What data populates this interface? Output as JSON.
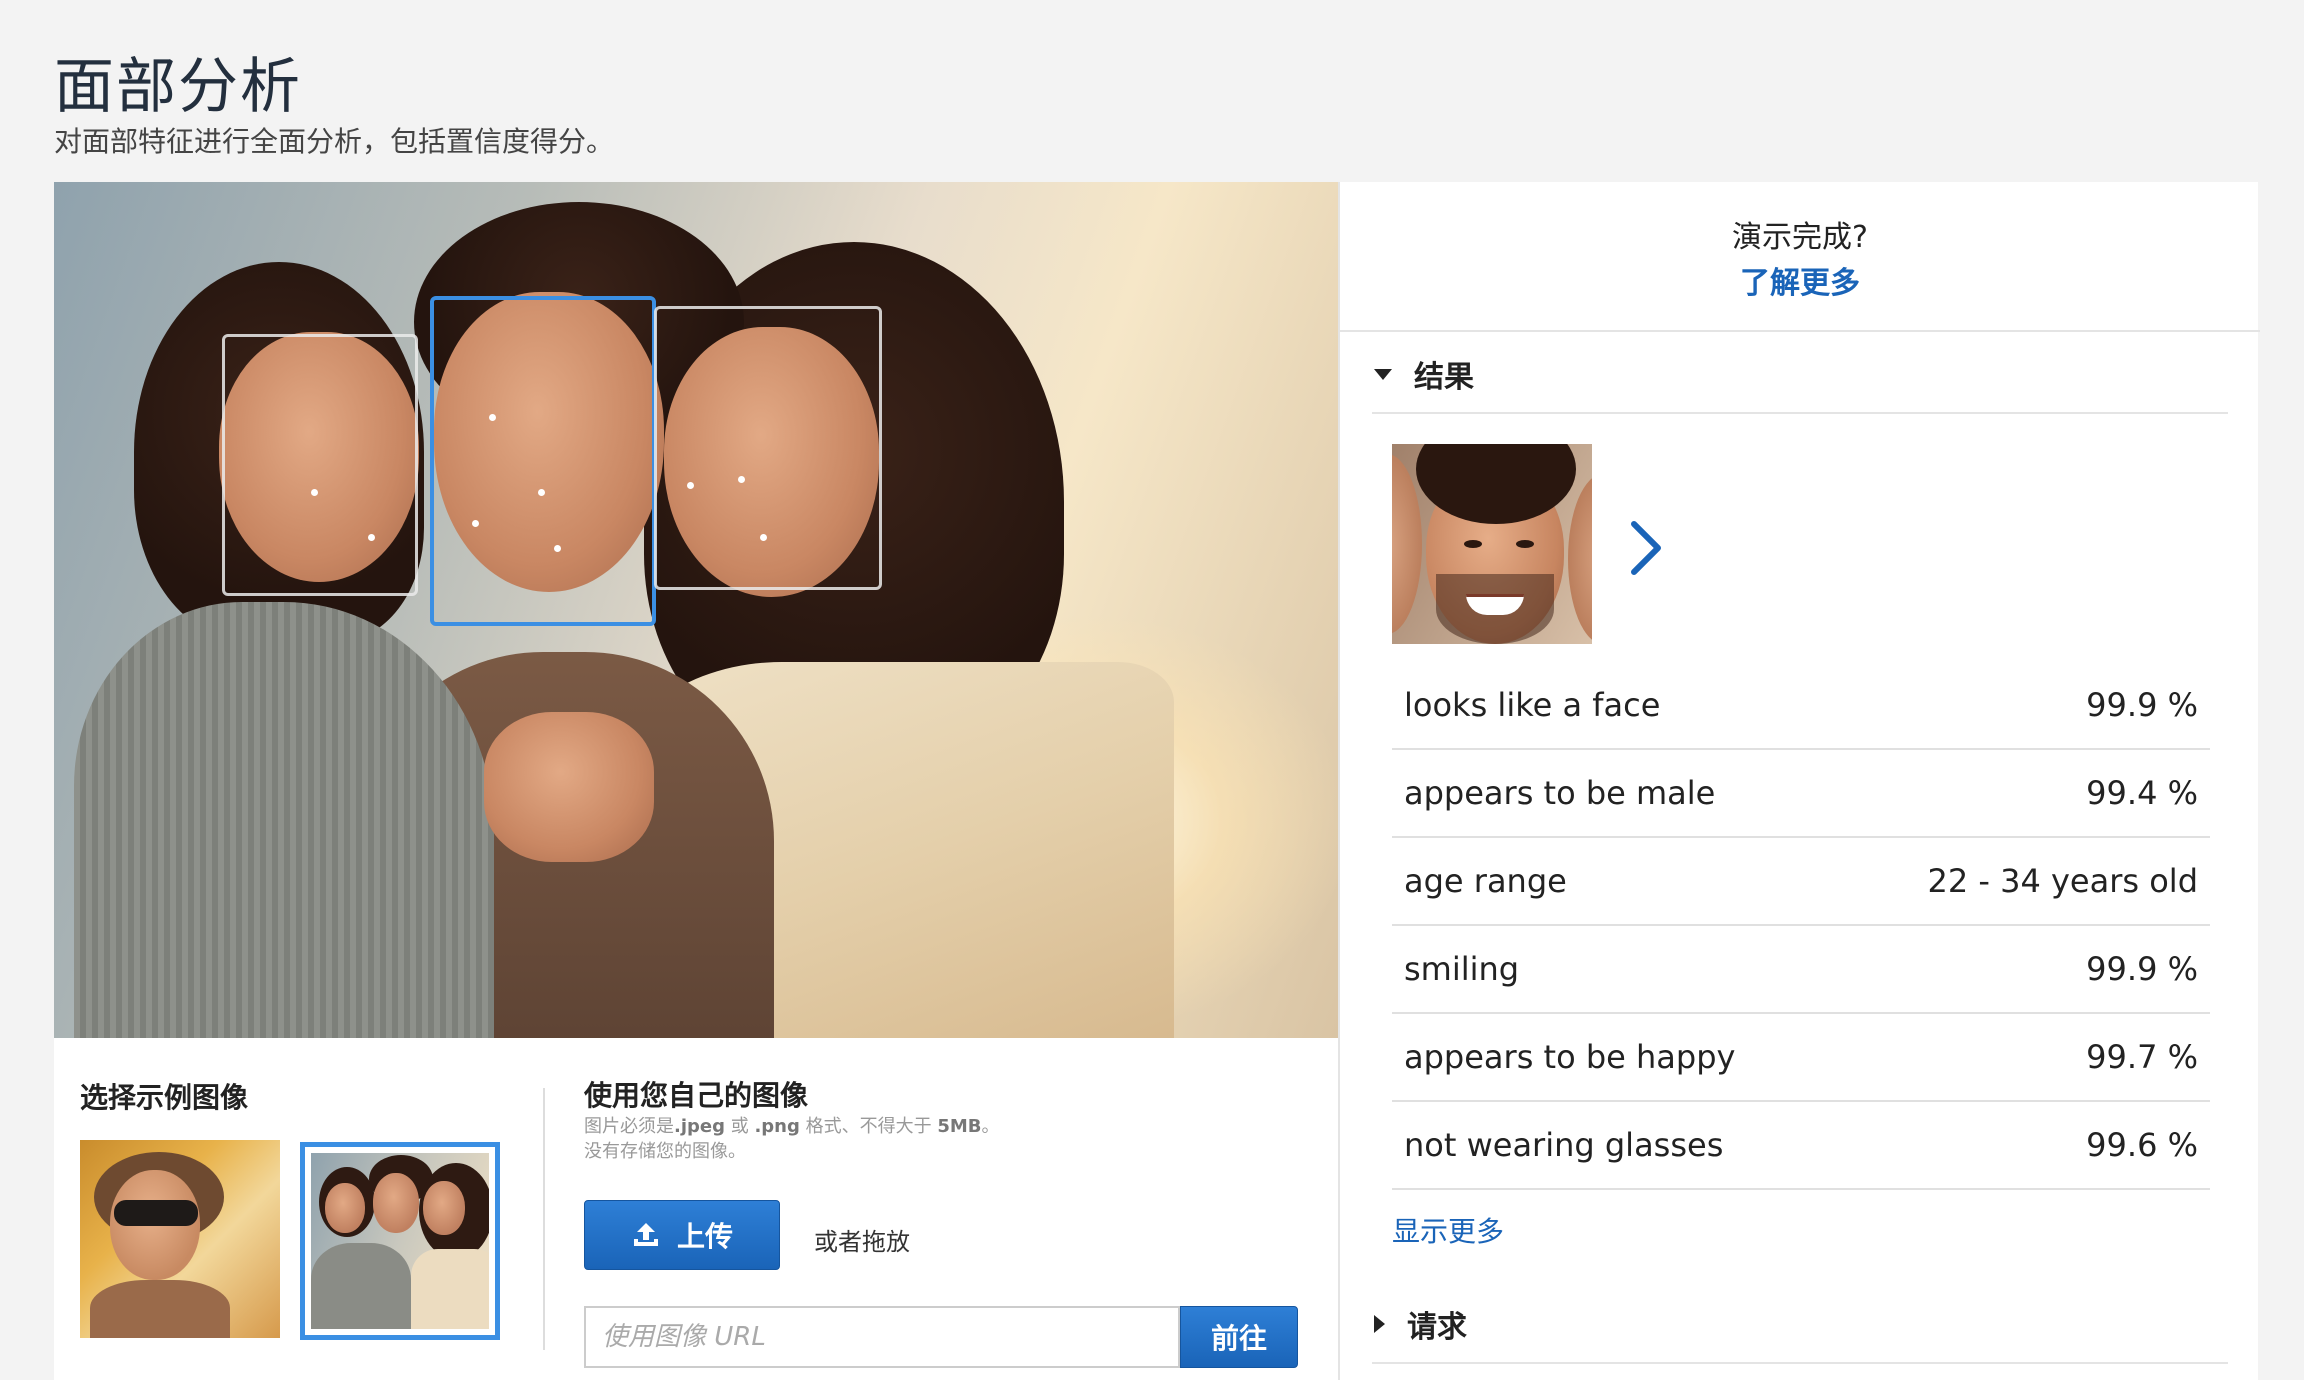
{
  "header": {
    "title": "面部分析",
    "subtitle": "对面部特征进行全面分析，包括置信度得分。"
  },
  "samples": {
    "heading": "选择示例图像"
  },
  "own_image": {
    "heading": "使用您自己的图像",
    "help_prefix": "图片必须是",
    "help_jpeg": ".jpeg",
    "help_or": " 或 ",
    "help_png": ".png",
    "help_mid": " 格式、不得大于 ",
    "help_size": "5MB",
    "help_suffix": "。没有存储您的图像。",
    "upload_label": "上传",
    "drop_text": "或者拖放",
    "url_placeholder": "使用图像 URL",
    "go_label": "前往"
  },
  "right_panel": {
    "demo_done": "演示完成?",
    "learn_more": "了解更多",
    "results_header": "结果",
    "request_header": "请求",
    "show_more": "显示更多",
    "results": [
      {
        "label": "looks like a face",
        "value": "99.9 %"
      },
      {
        "label": "appears to be male",
        "value": "99.4 %"
      },
      {
        "label": "age range",
        "value": "22 - 34 years old"
      },
      {
        "label": "smiling",
        "value": "99.9 %"
      },
      {
        "label": "appears to be happy",
        "value": "99.7 %"
      },
      {
        "label": "not wearing glasses",
        "value": "99.6 %"
      }
    ]
  },
  "icons": {
    "upload": "upload-icon",
    "chevron_next": "chevron-right-icon",
    "results_toggle": "caret-down-icon",
    "request_toggle": "caret-right-icon"
  },
  "colors": {
    "accent": "#1a64b8",
    "selected_border": "#3b8fe3"
  }
}
